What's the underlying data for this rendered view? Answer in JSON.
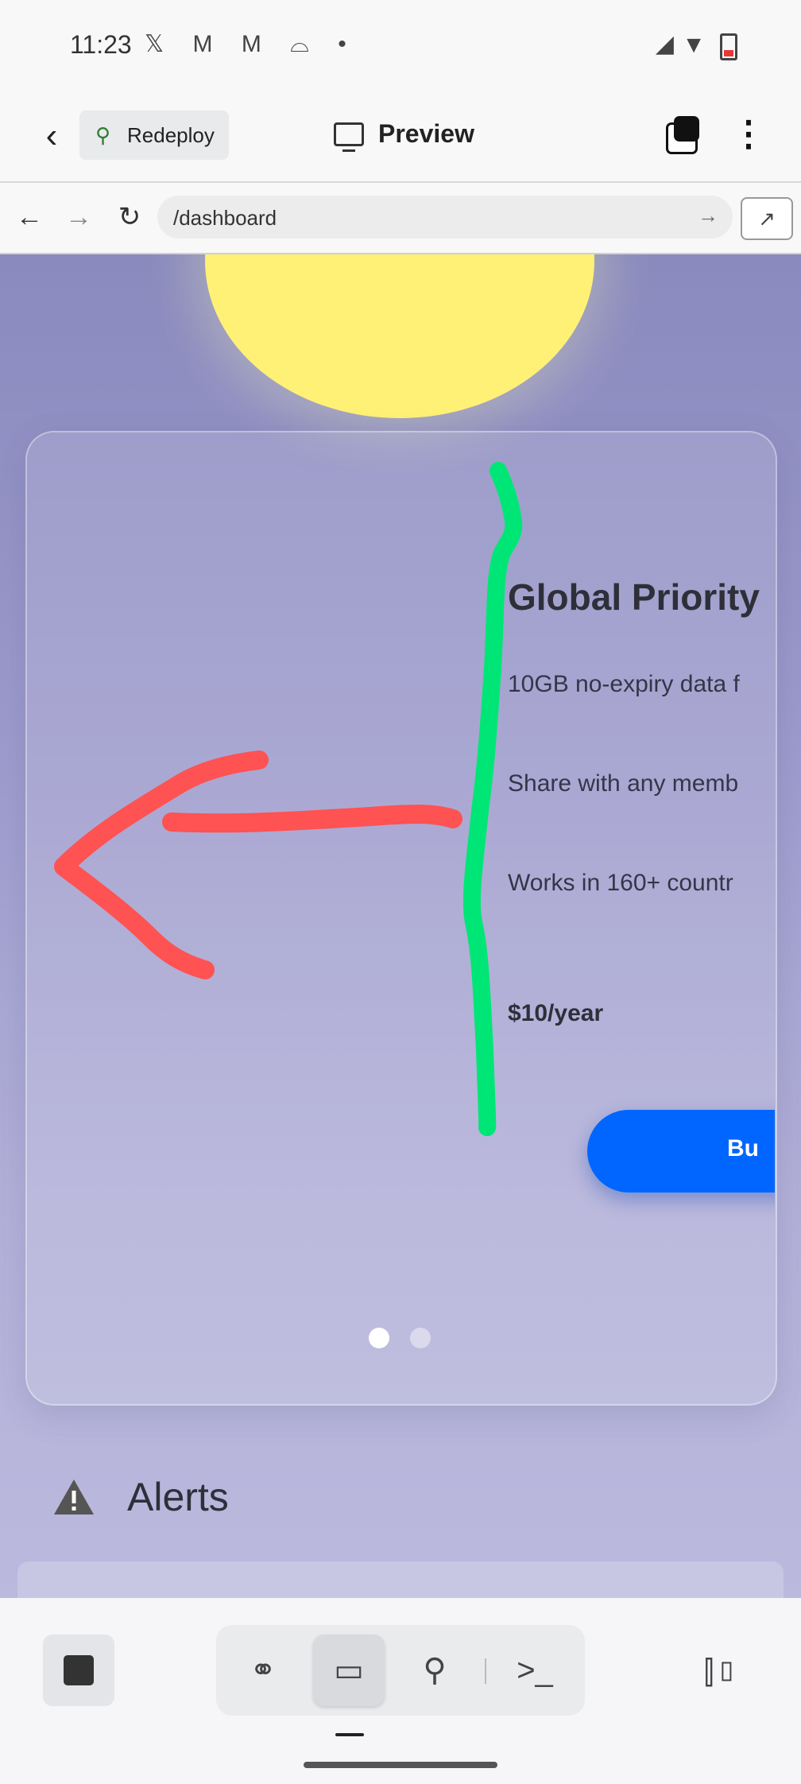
{
  "status_bar": {
    "time": "11:23",
    "notif_icons": "𝕏 M M ⌓ •"
  },
  "app_bar": {
    "redeploy_label": "Redeploy",
    "preview_label": "Preview"
  },
  "browser": {
    "url": "/dashboard"
  },
  "plan_card": {
    "title": "Global Priority",
    "features": [
      "10GB no-expiry data f",
      "Share with any memb",
      "Works in 160+ countr"
    ],
    "price": "$10/year",
    "buy_label": "Bu",
    "dots": [
      true,
      false
    ]
  },
  "alerts": {
    "title": "Alerts"
  },
  "annotation_colors": {
    "arrow": "#ff5252",
    "line": "#00e676"
  },
  "colors": {
    "accent": "#0066ff",
    "sun": "#fff176"
  }
}
